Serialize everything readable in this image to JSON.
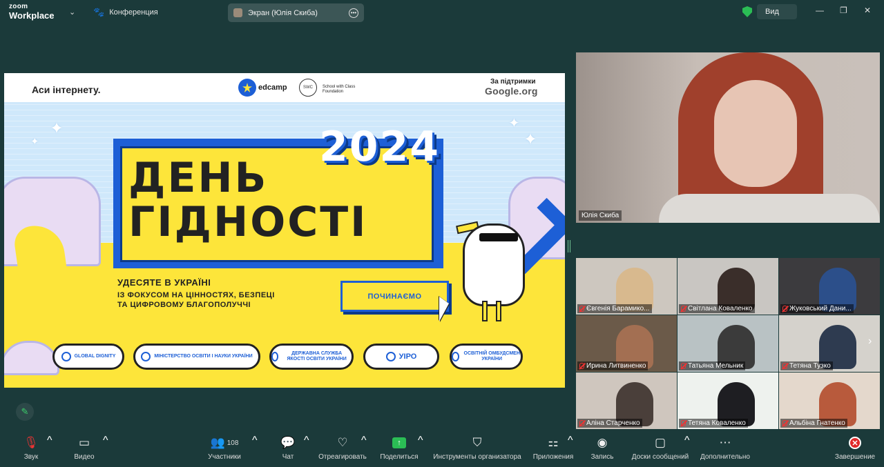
{
  "app": {
    "brand_top": "zoom",
    "brand_bottom": "Workplace",
    "meeting_name": "Конференция",
    "share_label": "Экран (Юлія Скиба)",
    "view_label": "Вид"
  },
  "colors": {
    "background": "#1b3a3a",
    "accent_green": "#2bbd55",
    "end_red": "#e02a2a",
    "slide_yellow": "#fde53a",
    "slide_blue": "#1d5fd6"
  },
  "slide": {
    "header_title": "Аси інтернету.",
    "edcamp": "edcamp",
    "swc_logo": "SWC",
    "swc_text": "School with Class Foundation",
    "support_line1": "За підтримки",
    "support_google": "Google",
    "support_org": ".org",
    "year": "2024",
    "title_line1": "ДЕНЬ",
    "title_line2": "ГІДНОСТІ",
    "subtitle": "УДЕСЯТЕ В УКРАЇНІ",
    "subline1": "ІЗ ФОКУСОМ НА ЦІННОСТЯХ, БЕЗПЕЦІ",
    "subline2": "ТА ЦИФРОВОМУ БЛАГОПОЛУЧЧІ",
    "cta": "ПОЧИНАЄМО",
    "partners": [
      "GLOBAL DIGNITY",
      "МІНІСТЕРСТВО ОСВІТИ І НАУКИ УКРАЇНИ",
      "ДЕРЖАВНА СЛУЖБА ЯКОСТІ ОСВІТИ УКРАЇНИ",
      "УІРО",
      "ОСВІТНІЙ ОМБУДСМЕН УКРАЇНИ"
    ]
  },
  "speaker": {
    "name": "Юлія Скиба"
  },
  "gallery": [
    {
      "name": "Євгенія Барамико..."
    },
    {
      "name": "Світлана Коваленко"
    },
    {
      "name": "Жуковський Дани..."
    },
    {
      "name": "Ирина Литвиненко"
    },
    {
      "name": "Татьяна Мельник"
    },
    {
      "name": "Тетяна Тузко"
    },
    {
      "name": "Аліна Старченко"
    },
    {
      "name": "Тетяна  Коваленко"
    },
    {
      "name": "Альбіна Гнатенко"
    }
  ],
  "toolbar": {
    "audio": "Звук",
    "video": "Видео",
    "participants": "Участники",
    "participants_count": "108",
    "chat": "Чат",
    "react": "Отреагировать",
    "share": "Поделиться",
    "host_tools": "Инструменты организатора",
    "apps": "Приложения",
    "record": "Запись",
    "whiteboards": "Доски сообщений",
    "more": "Дополнительно",
    "end": "Завершение"
  }
}
